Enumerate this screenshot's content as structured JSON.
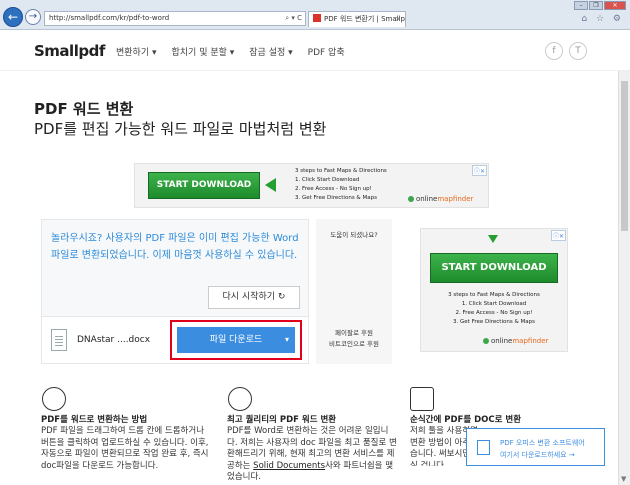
{
  "browser": {
    "url": "http://smallpdf.com/kr/pdf-to-word",
    "tab_title": "PDF 워드 변환기 | Smallp...",
    "tab_close": "×",
    "back": "←",
    "forward": "→",
    "address_icons": "⌕ ▾ C",
    "window_buttons": [
      "–",
      "❐",
      "✕"
    ],
    "toolbar_icons": "⌂ ☆ ⚙"
  },
  "header": {
    "logo": "Smallpdf",
    "menu": [
      "변환하기 ▾",
      "합치기 및 분할 ▾",
      "잠금 설정 ▾",
      "PDF 압축"
    ],
    "social_facebook": "f",
    "social_twitter": "T"
  },
  "main": {
    "title": "PDF 워드 변환",
    "subtitle": "PDF를 편집 가능한 워드 파일로 마법처럼 변환"
  },
  "ad_top": {
    "button": "START DOWNLOAD",
    "steps_title": "3 steps to Fast Maps & Directions",
    "step1": "1. Click Start Download",
    "step2": "2. Free Access - No Sign up!",
    "step3": "3. Get Free Directions & Maps",
    "logo_text": "online",
    "logo_accent": "mapfinder",
    "close_label": "ⓘ✕"
  },
  "result": {
    "message": "놀라우시죠? 사용자의 PDF 파일은 이미 편집 가능한 Word 파일로 변환되었습니다. 이제 마음껏 사용하실 수 있습니다.",
    "restart_label": "다시 시작하기 ↻",
    "file_name": "DNAstar ....docx",
    "download_label": "파일 다운로드",
    "download_caret": "▾"
  },
  "help": {
    "question": "도움이 되셨나요?",
    "answer_line1": "페이팔로 후원",
    "answer_line2": "비트코인으로 후원"
  },
  "ad_right": {
    "button": "START DOWNLOAD",
    "steps_title": "3 steps to Fast Maps & Directions",
    "step1": "1. Click Start Download",
    "step2": "2. Free Access - No Sign up!",
    "step3": "3. Get Free Directions & Maps",
    "logo_text": "online",
    "logo_accent": "mapfinder",
    "close_label": "ⓘ✕"
  },
  "features": [
    {
      "title": "PDF를 워드로 변환하는 방법",
      "text": "PDF 파일을 드래그하여 드롭 칸에 드롭하거나 버튼을 클릭하여 업로드하실 수 있습니다. 이후, 자동으로 파일이 변환되므로 작업 완료 후, 즉시 doc파일을 다운로드 가능합니다."
    },
    {
      "title": "최고 퀄리티의 PDF 워드 변환",
      "text_before": "PDF를 Word로 변환하는 것은 어려운 일입니다. 저희는 사용자의 doc 파일을 최고 품질로 변환해드리기 위해, 현재 최고의 변환 서비스를 제공하는 ",
      "link": "Solid Documents",
      "text_after": "사와 파트너쉽을 맺었습니다."
    },
    {
      "title": "순식간에 PDF를 DOC로 변환",
      "text": "저희 툴을 사용하면 변환 방법이 아주 쉽습니다. 써보시면 아실 겁니다."
    }
  ],
  "promo": {
    "line1": "PDF 오피스 변환 소프트웨어",
    "line2": "여기서 다운로드하세요 →"
  },
  "colors": {
    "accent_blue": "#3b8de0",
    "highlight_red": "#e0001b",
    "ad_green": "#24a032"
  }
}
